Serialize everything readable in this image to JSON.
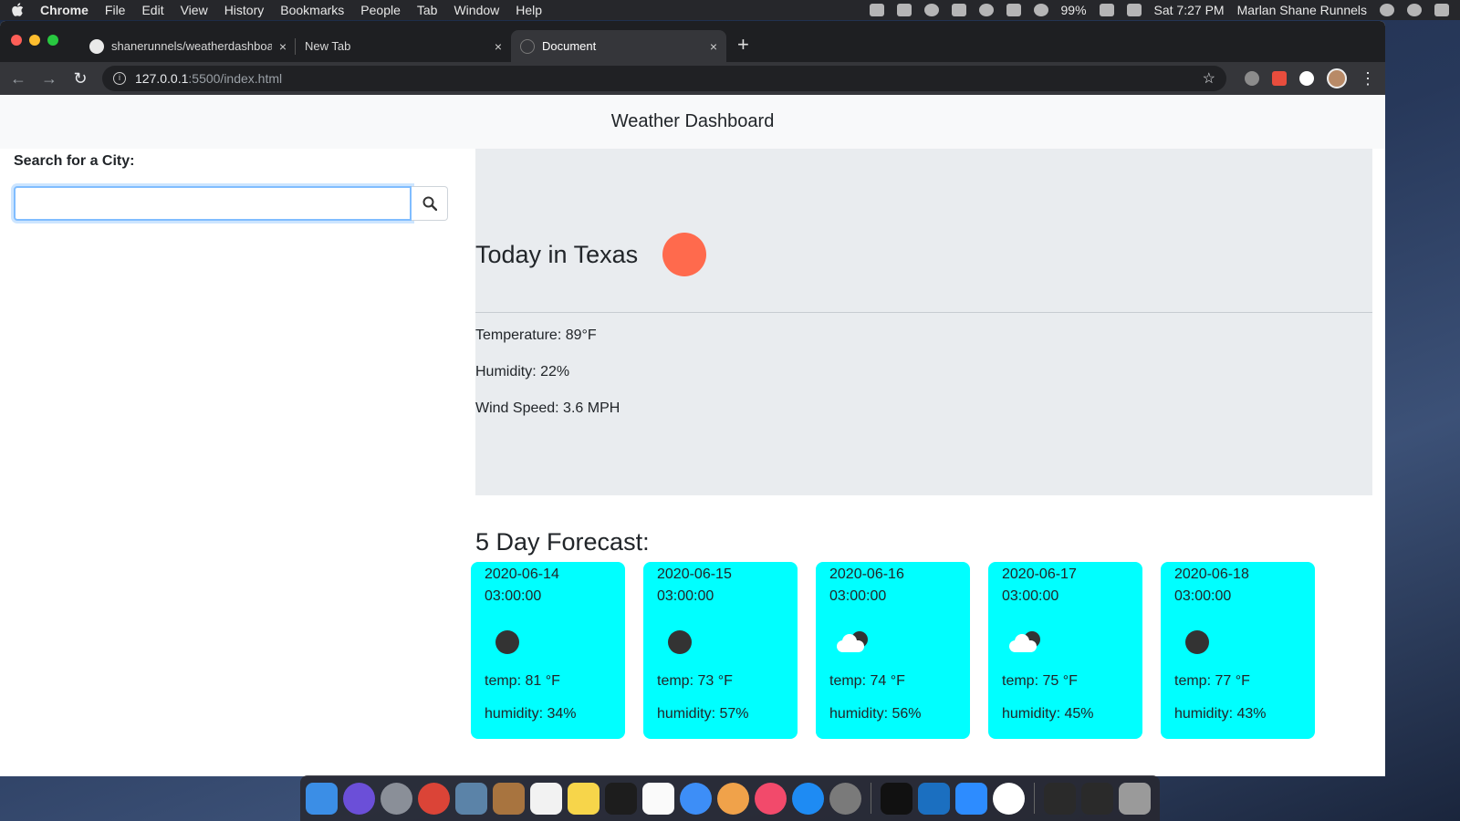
{
  "menubar": {
    "app_name": "Chrome",
    "items": [
      "File",
      "Edit",
      "View",
      "History",
      "Bookmarks",
      "People",
      "Tab",
      "Window",
      "Help"
    ],
    "battery": "99%",
    "clock": "Sat 7:27 PM",
    "user": "Marlan Shane Runnels"
  },
  "browser": {
    "tabs": [
      {
        "title": "shanerunnels/weatherdashboard",
        "close": "×"
      },
      {
        "title": "New Tab",
        "close": "×"
      },
      {
        "title": "Document",
        "close": "×"
      }
    ],
    "new_tab": "+",
    "url_host": "127.0.0.1",
    "url_rest": ":5500/index.html"
  },
  "page": {
    "navbar_title": "Weather Dashboard",
    "search_label": "Search for a City:",
    "search_value": "",
    "current": {
      "heading": "Today in Texas",
      "temperature": "Temperature: 89°F",
      "humidity": "Humidity: 22%",
      "wind": "Wind Speed: 3.6 MPH"
    },
    "forecast_title": "5 Day Forecast:",
    "forecast": [
      {
        "date": "2020-06-14",
        "time": "03:00:00",
        "icon": "dark-circle-icon",
        "temp": "temp: 81 °F",
        "humidity": "humidity: 34%"
      },
      {
        "date": "2020-06-15",
        "time": "03:00:00",
        "icon": "dark-circle-icon",
        "temp": "temp: 73 °F",
        "humidity": "humidity: 57%"
      },
      {
        "date": "2020-06-16",
        "time": "03:00:00",
        "icon": "cloud-icon",
        "temp": "temp: 74 °F",
        "humidity": "humidity: 56%"
      },
      {
        "date": "2020-06-17",
        "time": "03:00:00",
        "icon": "cloud-icon",
        "temp": "temp: 75 °F",
        "humidity": "humidity: 45%"
      },
      {
        "date": "2020-06-18",
        "time": "03:00:00",
        "icon": "dark-circle-icon",
        "temp": "temp: 77 °F",
        "humidity": "humidity: 43%"
      }
    ]
  },
  "colors": {
    "card_bg": "#00ffff",
    "sun": "#ff6a4d",
    "jumbotron_bg": "#e9ecef",
    "navbar_bg": "#f8f9fa"
  }
}
